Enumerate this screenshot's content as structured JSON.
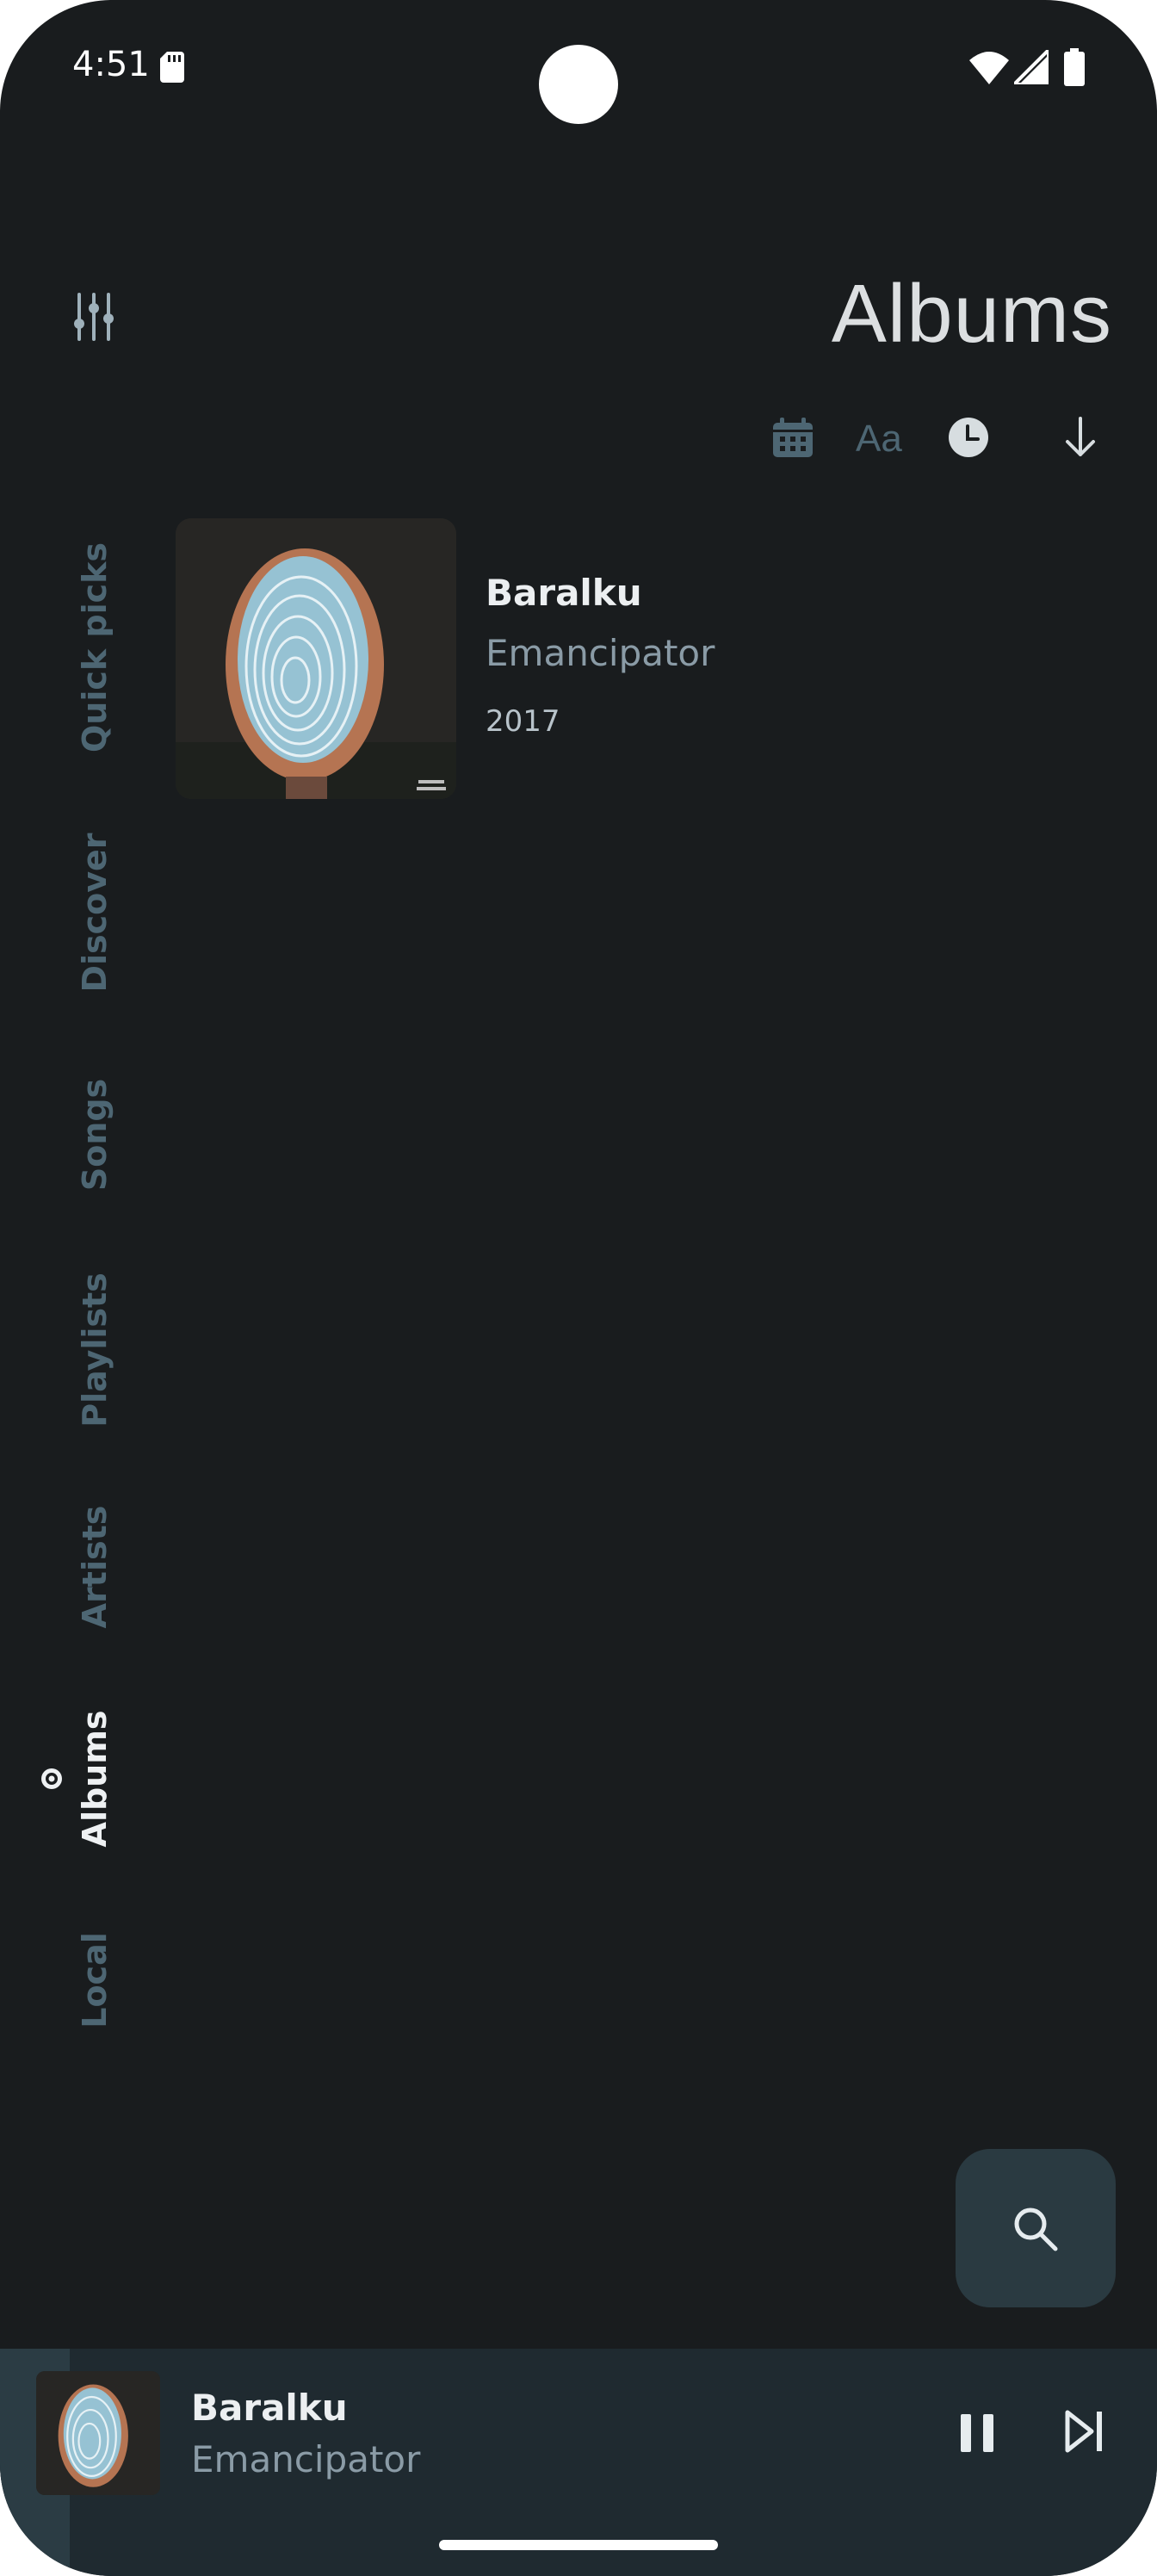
{
  "status_bar": {
    "time": "4:51"
  },
  "header": {
    "title": "Albums",
    "sort_options": [
      {
        "icon": "calendar-icon",
        "active": true
      },
      {
        "icon": "alphabetical-aa-icon",
        "label": "Aa",
        "active": false
      },
      {
        "icon": "clock-icon",
        "active": false
      },
      {
        "icon": "arrow-down-icon",
        "active": false
      }
    ]
  },
  "side_nav": {
    "items": [
      {
        "label": "Quick picks",
        "active": false
      },
      {
        "label": "Discover",
        "active": false
      },
      {
        "label": "Songs",
        "active": false
      },
      {
        "label": "Playlists",
        "active": false
      },
      {
        "label": "Artists",
        "active": false
      },
      {
        "label": "Albums",
        "active": true
      },
      {
        "label": "Local",
        "active": false
      }
    ]
  },
  "albums": [
    {
      "title": "Baralku",
      "artist": "Emancipator",
      "year": "2017"
    }
  ],
  "mini_player": {
    "title": "Baralku",
    "artist": "Emancipator",
    "progress_fraction": 0.06
  },
  "colors": {
    "background": "#191c1e",
    "accent": "#4d6673",
    "fab_background": "#2a3a41",
    "player_background": "#1f2a30"
  }
}
